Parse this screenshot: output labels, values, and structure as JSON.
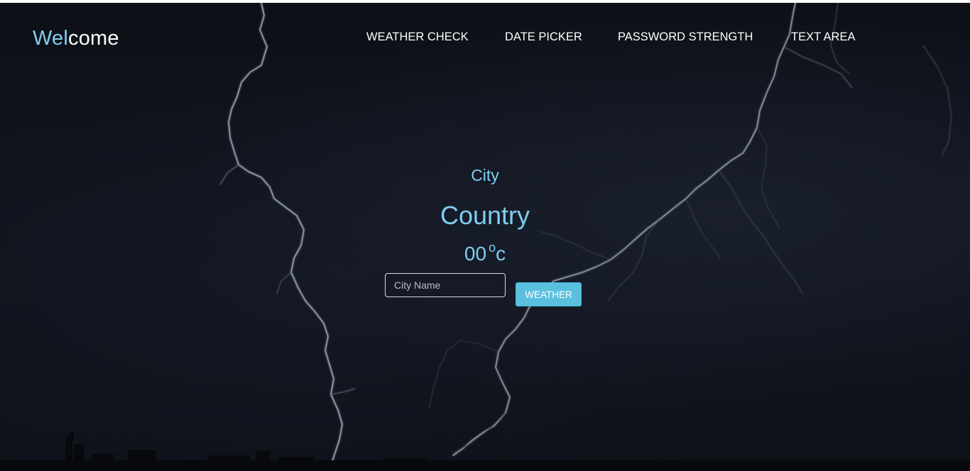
{
  "brand": {
    "accent_part": "Wel",
    "rest_part": "come",
    "accent_color": "#7fcef0"
  },
  "nav": {
    "items": [
      {
        "label": "WEATHER CHECK"
      },
      {
        "label": "DATE PICKER"
      },
      {
        "label": "PASSWORD STRENGTH"
      },
      {
        "label": "TEXT AREA"
      }
    ]
  },
  "weather": {
    "city": "City",
    "country": "Country",
    "temperature": "00",
    "degree_symbol": "o",
    "unit": "c",
    "text_color": "#7fcef0"
  },
  "form": {
    "city_input_placeholder": "City Name",
    "city_input_value": "",
    "button_label": "WEATHER",
    "button_color": "#5bc0de"
  },
  "background": {
    "description_icon": "lightning-storm-background"
  }
}
